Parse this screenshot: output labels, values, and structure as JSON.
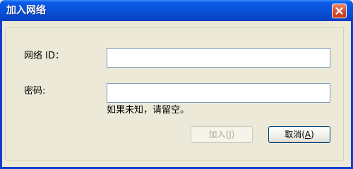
{
  "window": {
    "title": "加入网络"
  },
  "form": {
    "network_id_label": "网络 ID：",
    "network_id_value": "",
    "password_label": "密码:",
    "password_value": "",
    "hint": "如果未知，请留空。"
  },
  "buttons": {
    "join_label": "加入(",
    "join_accel": "J",
    "join_suffix": ")",
    "cancel_label": "取消(",
    "cancel_accel": "A",
    "cancel_suffix": ")"
  },
  "colors": {
    "titlebar": "#0850d6",
    "frame": "#0a3fd0",
    "client": "#ece9d8",
    "close_button": "#d2492a"
  },
  "icons": {
    "close": "close-icon"
  }
}
